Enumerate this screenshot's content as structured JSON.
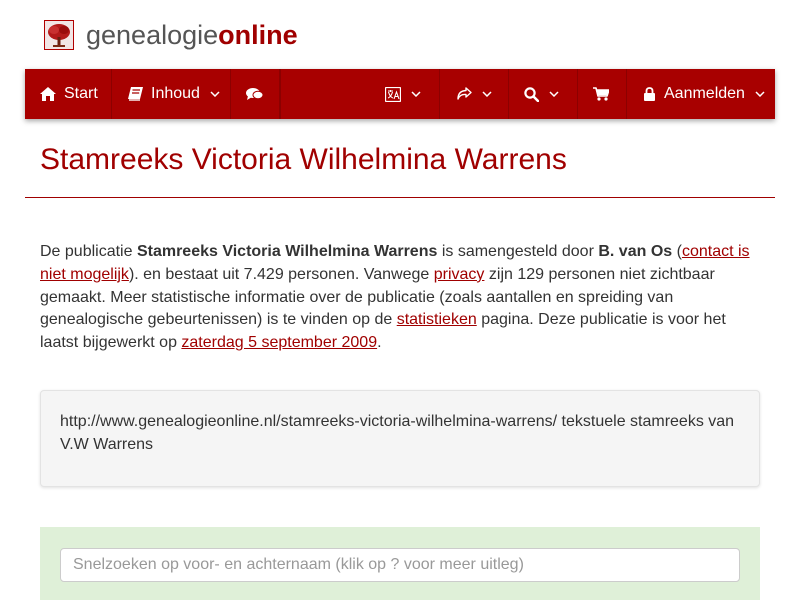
{
  "brand": {
    "name_part1": "genealogie",
    "name_part2": "online"
  },
  "nav": {
    "start_label": "Start",
    "inhoud_label": "Inhoud",
    "login_label": "Aanmelden",
    "icons": [
      "home-icon",
      "book-icon",
      "comments-icon",
      "language-icon",
      "share-icon",
      "search-icon",
      "cart-icon",
      "lock-icon",
      "chevron-down-icon"
    ]
  },
  "page": {
    "title": "Stamreeks Victoria Wilhelmina Warrens"
  },
  "intro": {
    "t1": "De publicatie ",
    "publication_name": "Stamreeks Victoria Wilhelmina Warrens",
    "t2": " is samengesteld door ",
    "author": "B. van Os",
    "t3": " (",
    "contact_link": "contact is niet mogelijk",
    "t4": "). en bestaat uit 7.429 personen. Vanwege ",
    "privacy_link": "privacy",
    "t5": " zijn 129 personen niet zichtbaar gemaakt. Meer statistische informatie over de publicatie (zoals aantallen en spreiding van genealogische gebeurtenissen) is te vinden op de ",
    "stats_link": "statistieken",
    "t6": " pagina. Deze publicatie is voor het laatst bijgewerkt op ",
    "date_link": "zaterdag 5 september 2009",
    "t7": "."
  },
  "description": "http://www.genealogieonline.nl/stamreeks-victoria-wilhelmina-warrens/ tekstuele stamreeks van V.W Warrens",
  "search": {
    "placeholder": "Snelzoeken op voor- en achternaam (klik op ? voor meer uitleg)"
  },
  "colors": {
    "accent": "#a00000",
    "navbar": "#a80000",
    "search_panel": "#dff0d8"
  }
}
